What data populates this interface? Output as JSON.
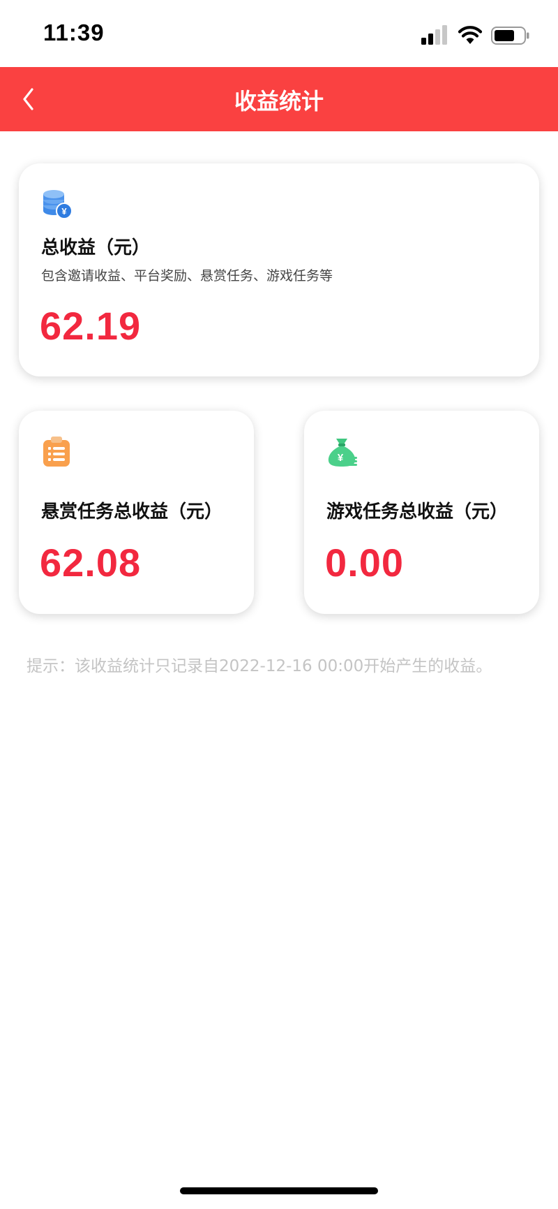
{
  "status_bar": {
    "time": "11:39",
    "icons": [
      "signal-icon",
      "wifi-icon",
      "battery-icon"
    ]
  },
  "header": {
    "title": "收益统计",
    "back_icon": "chevron-left-icon",
    "background_color": "#fa4141"
  },
  "total_card": {
    "icon": "coins-yuan-icon",
    "label": "总收益（元）",
    "description": "包含邀请收益、平台奖励、悬赏任务、游戏任务等",
    "value": "62.19"
  },
  "reward_card": {
    "icon": "clipboard-list-icon",
    "label": "悬赏任务总收益（元）",
    "value": "62.08"
  },
  "game_card": {
    "icon": "money-bag-icon",
    "label": "游戏任务总收益（元）",
    "value": "0.00"
  },
  "tip": "提示：该收益统计只记录自2022-12-16 00:00开始产生的收益。",
  "colors": {
    "accent": "#fa4141",
    "value": "#f2283f",
    "tip": "#c4c4c4"
  }
}
